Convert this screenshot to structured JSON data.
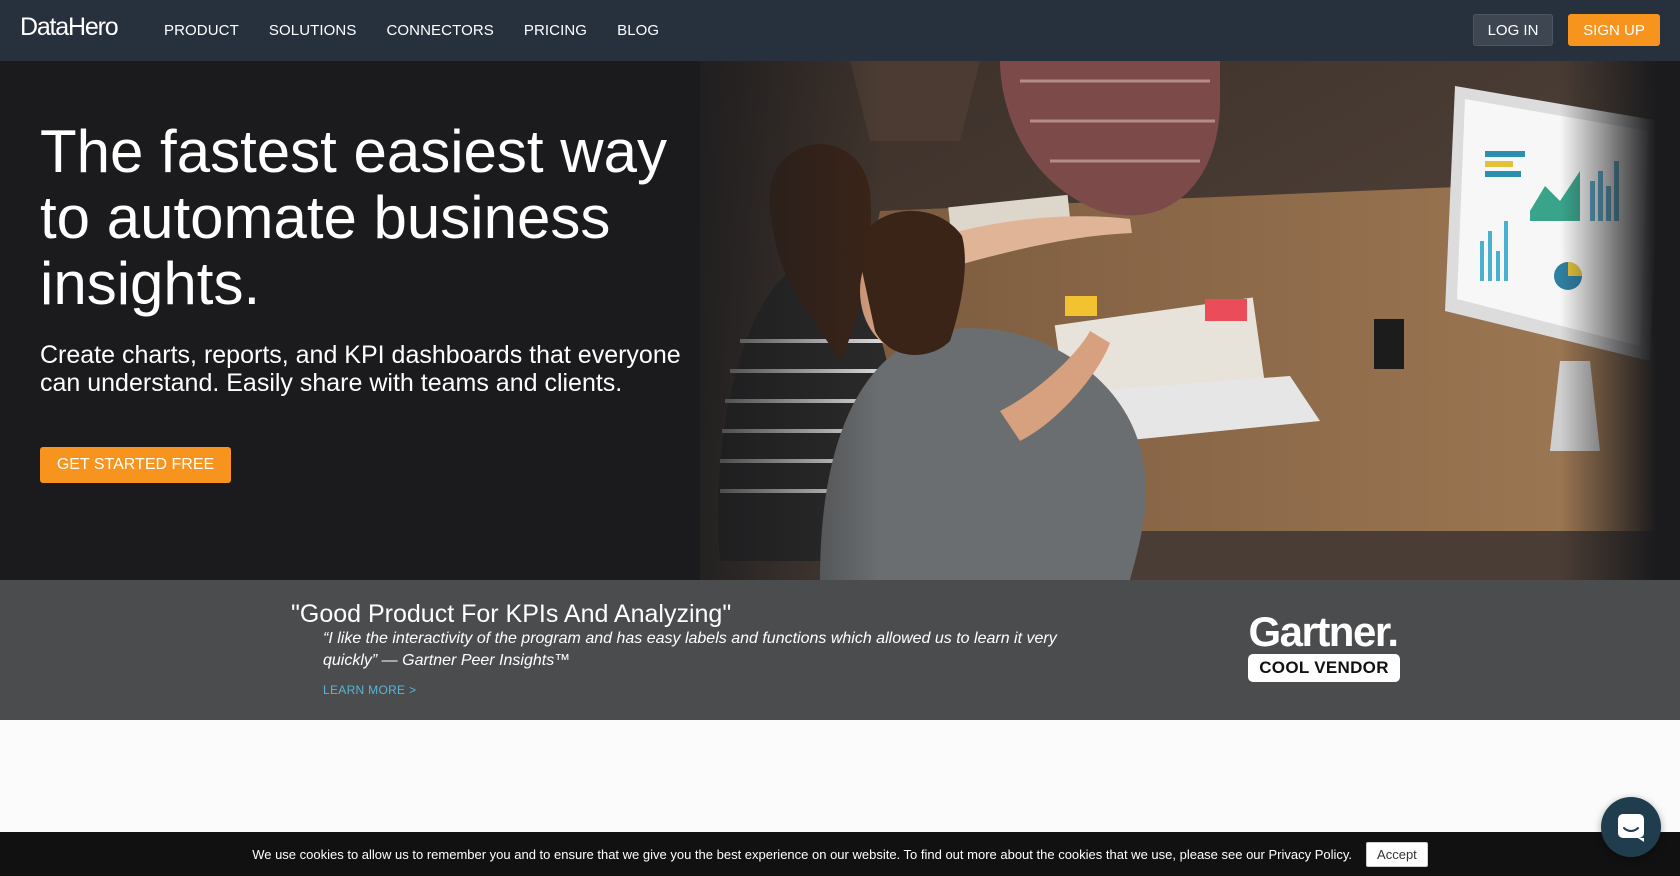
{
  "nav": {
    "logo": "DataHero",
    "links": [
      "PRODUCT",
      "SOLUTIONS",
      "CONNECTORS",
      "PRICING",
      "BLOG"
    ],
    "login_label": "LOG IN",
    "signup_label": "SIGN UP"
  },
  "hero": {
    "title": "The fastest easiest way to automate business insights.",
    "subtitle": "Create charts, reports, and KPI dashboards that everyone can understand. Easily share with teams and clients.",
    "cta_label": "GET STARTED FREE"
  },
  "testimonial": {
    "title": "\"Good Product For KPIs And Analyzing\"",
    "quote": "“I like the interactivity of the program and has easy labels and functions which allowed us to learn it very quickly”  — Gartner Peer Insights™",
    "link_label": "LEARN MORE >",
    "badge_word": "Gartner.",
    "badge_label": "COOL VENDOR"
  },
  "cookie": {
    "text": "We use cookies to allow us to remember you and to ensure that we give you the best experience on our website. To find out more about the cookies that we use, please see our Privacy Policy.",
    "accept_label": "Accept"
  },
  "chat": {
    "icon": "chat-icon"
  },
  "colors": {
    "nav_bg": "#27313e",
    "accent": "#f7941d",
    "testimonial_bg": "#4b4c4e",
    "link": "#58b6d6"
  }
}
